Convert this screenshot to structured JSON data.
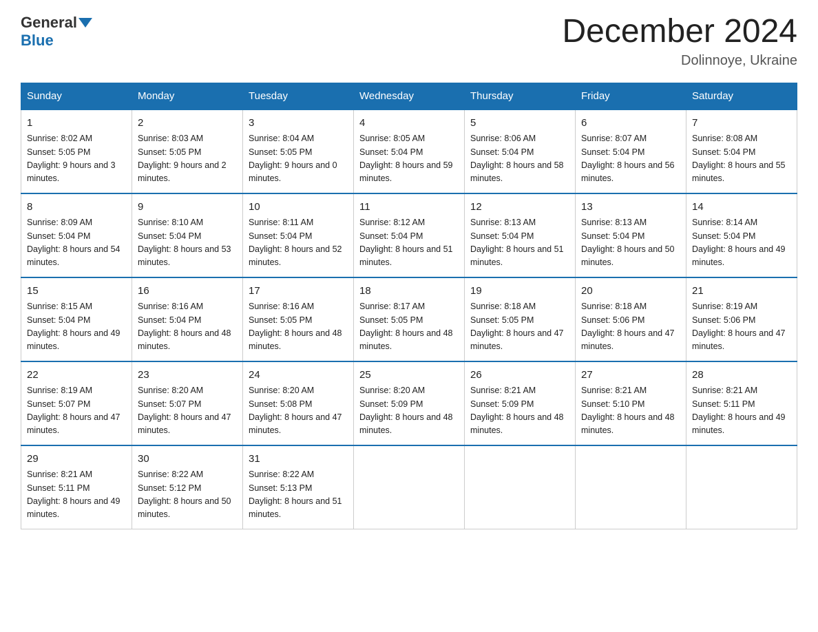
{
  "logo": {
    "general": "General",
    "blue": "Blue"
  },
  "title": "December 2024",
  "location": "Dolinnoye, Ukraine",
  "days_header": [
    "Sunday",
    "Monday",
    "Tuesday",
    "Wednesday",
    "Thursday",
    "Friday",
    "Saturday"
  ],
  "weeks": [
    [
      {
        "day": "1",
        "sunrise": "8:02 AM",
        "sunset": "5:05 PM",
        "daylight": "9 hours and 3 minutes."
      },
      {
        "day": "2",
        "sunrise": "8:03 AM",
        "sunset": "5:05 PM",
        "daylight": "9 hours and 2 minutes."
      },
      {
        "day": "3",
        "sunrise": "8:04 AM",
        "sunset": "5:05 PM",
        "daylight": "9 hours and 0 minutes."
      },
      {
        "day": "4",
        "sunrise": "8:05 AM",
        "sunset": "5:04 PM",
        "daylight": "8 hours and 59 minutes."
      },
      {
        "day": "5",
        "sunrise": "8:06 AM",
        "sunset": "5:04 PM",
        "daylight": "8 hours and 58 minutes."
      },
      {
        "day": "6",
        "sunrise": "8:07 AM",
        "sunset": "5:04 PM",
        "daylight": "8 hours and 56 minutes."
      },
      {
        "day": "7",
        "sunrise": "8:08 AM",
        "sunset": "5:04 PM",
        "daylight": "8 hours and 55 minutes."
      }
    ],
    [
      {
        "day": "8",
        "sunrise": "8:09 AM",
        "sunset": "5:04 PM",
        "daylight": "8 hours and 54 minutes."
      },
      {
        "day": "9",
        "sunrise": "8:10 AM",
        "sunset": "5:04 PM",
        "daylight": "8 hours and 53 minutes."
      },
      {
        "day": "10",
        "sunrise": "8:11 AM",
        "sunset": "5:04 PM",
        "daylight": "8 hours and 52 minutes."
      },
      {
        "day": "11",
        "sunrise": "8:12 AM",
        "sunset": "5:04 PM",
        "daylight": "8 hours and 51 minutes."
      },
      {
        "day": "12",
        "sunrise": "8:13 AM",
        "sunset": "5:04 PM",
        "daylight": "8 hours and 51 minutes."
      },
      {
        "day": "13",
        "sunrise": "8:13 AM",
        "sunset": "5:04 PM",
        "daylight": "8 hours and 50 minutes."
      },
      {
        "day": "14",
        "sunrise": "8:14 AM",
        "sunset": "5:04 PM",
        "daylight": "8 hours and 49 minutes."
      }
    ],
    [
      {
        "day": "15",
        "sunrise": "8:15 AM",
        "sunset": "5:04 PM",
        "daylight": "8 hours and 49 minutes."
      },
      {
        "day": "16",
        "sunrise": "8:16 AM",
        "sunset": "5:04 PM",
        "daylight": "8 hours and 48 minutes."
      },
      {
        "day": "17",
        "sunrise": "8:16 AM",
        "sunset": "5:05 PM",
        "daylight": "8 hours and 48 minutes."
      },
      {
        "day": "18",
        "sunrise": "8:17 AM",
        "sunset": "5:05 PM",
        "daylight": "8 hours and 48 minutes."
      },
      {
        "day": "19",
        "sunrise": "8:18 AM",
        "sunset": "5:05 PM",
        "daylight": "8 hours and 47 minutes."
      },
      {
        "day": "20",
        "sunrise": "8:18 AM",
        "sunset": "5:06 PM",
        "daylight": "8 hours and 47 minutes."
      },
      {
        "day": "21",
        "sunrise": "8:19 AM",
        "sunset": "5:06 PM",
        "daylight": "8 hours and 47 minutes."
      }
    ],
    [
      {
        "day": "22",
        "sunrise": "8:19 AM",
        "sunset": "5:07 PM",
        "daylight": "8 hours and 47 minutes."
      },
      {
        "day": "23",
        "sunrise": "8:20 AM",
        "sunset": "5:07 PM",
        "daylight": "8 hours and 47 minutes."
      },
      {
        "day": "24",
        "sunrise": "8:20 AM",
        "sunset": "5:08 PM",
        "daylight": "8 hours and 47 minutes."
      },
      {
        "day": "25",
        "sunrise": "8:20 AM",
        "sunset": "5:09 PM",
        "daylight": "8 hours and 48 minutes."
      },
      {
        "day": "26",
        "sunrise": "8:21 AM",
        "sunset": "5:09 PM",
        "daylight": "8 hours and 48 minutes."
      },
      {
        "day": "27",
        "sunrise": "8:21 AM",
        "sunset": "5:10 PM",
        "daylight": "8 hours and 48 minutes."
      },
      {
        "day": "28",
        "sunrise": "8:21 AM",
        "sunset": "5:11 PM",
        "daylight": "8 hours and 49 minutes."
      }
    ],
    [
      {
        "day": "29",
        "sunrise": "8:21 AM",
        "sunset": "5:11 PM",
        "daylight": "8 hours and 49 minutes."
      },
      {
        "day": "30",
        "sunrise": "8:22 AM",
        "sunset": "5:12 PM",
        "daylight": "8 hours and 50 minutes."
      },
      {
        "day": "31",
        "sunrise": "8:22 AM",
        "sunset": "5:13 PM",
        "daylight": "8 hours and 51 minutes."
      },
      null,
      null,
      null,
      null
    ]
  ]
}
